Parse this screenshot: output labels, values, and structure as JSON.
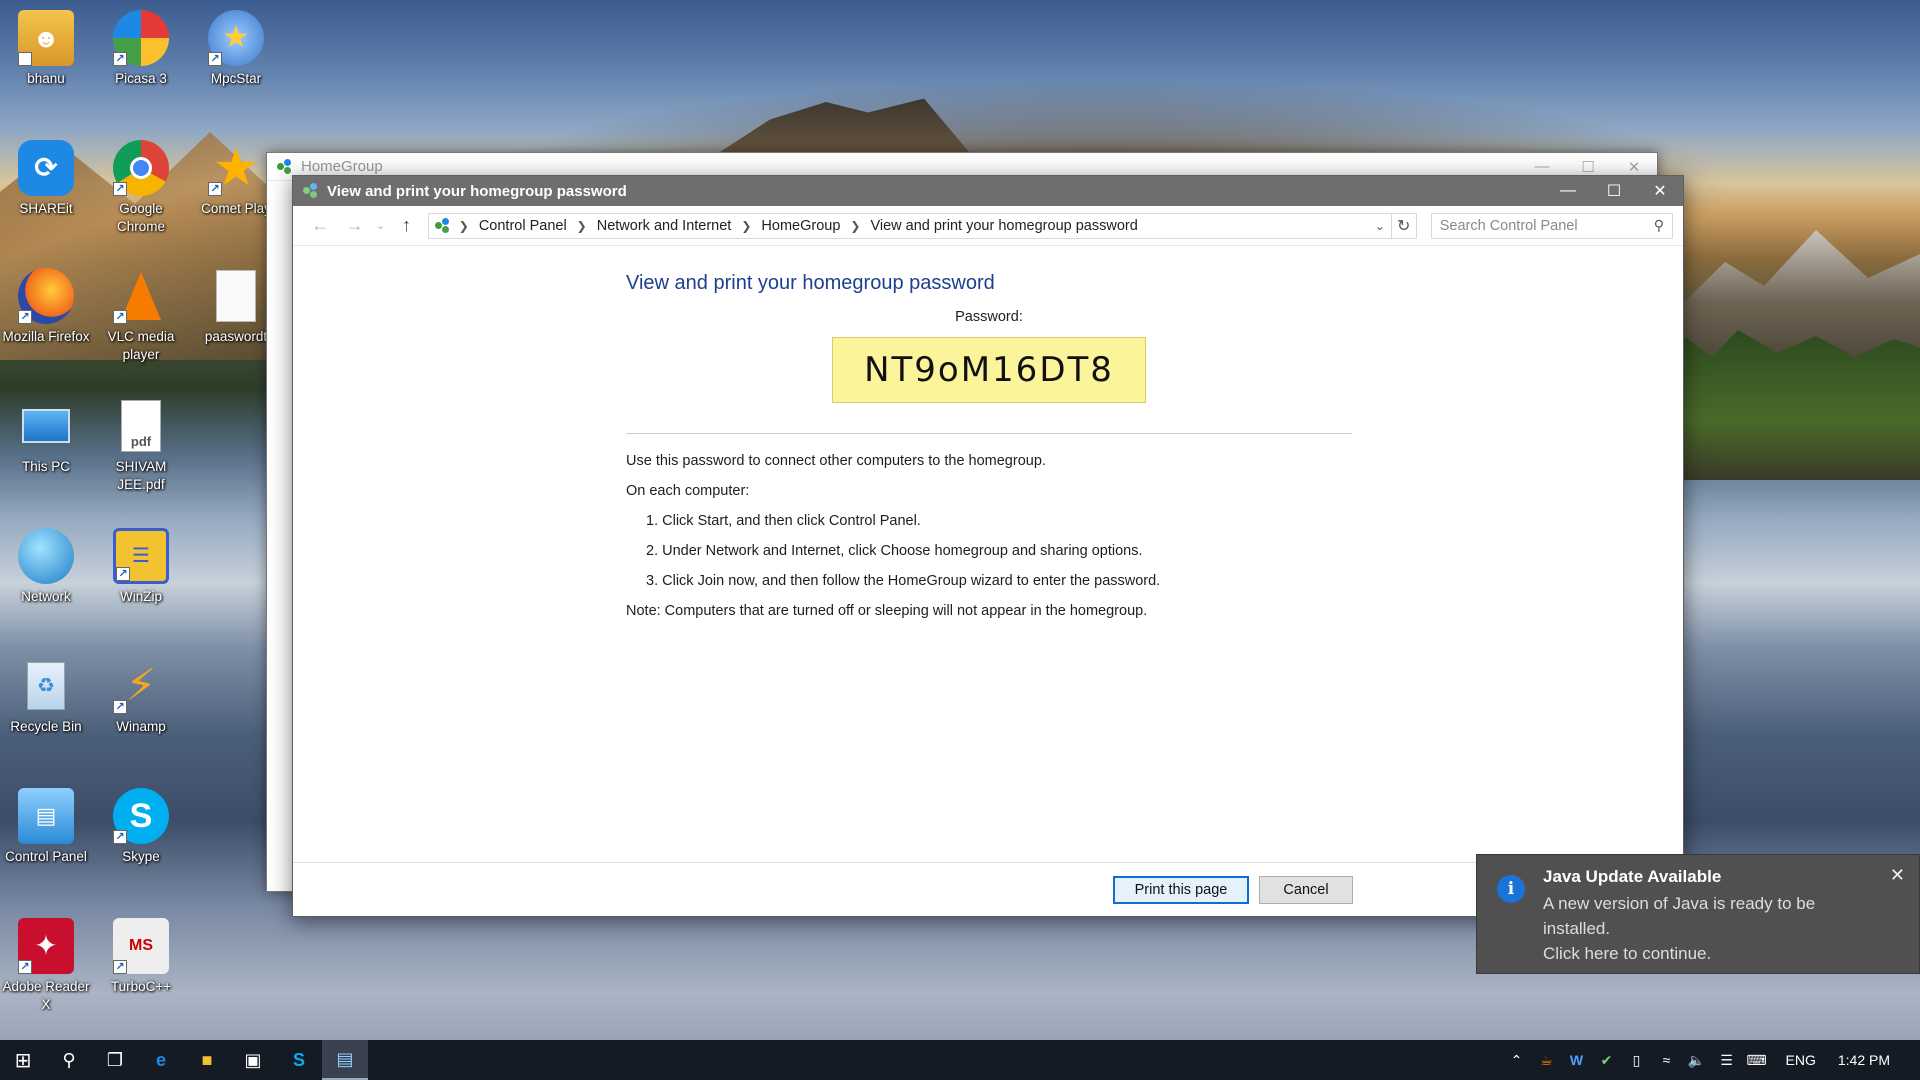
{
  "desktop": {
    "icons": [
      {
        "label": "bhanu"
      },
      {
        "label": "Picasa 3"
      },
      {
        "label": "MpcStar"
      },
      {
        "label": "SHAREit"
      },
      {
        "label": "Google Chrome"
      },
      {
        "label": "Comet Play"
      },
      {
        "label": "Mozilla Firefox"
      },
      {
        "label": "VLC media player"
      },
      {
        "label": "paaswordt"
      },
      {
        "label": "This PC"
      },
      {
        "label": "SHIVAM JEE.pdf"
      },
      {
        "label": "Network"
      },
      {
        "label": "WinZip"
      },
      {
        "label": "Recycle Bin"
      },
      {
        "label": "Winamp"
      },
      {
        "label": "Control Panel"
      },
      {
        "label": "Skype"
      },
      {
        "label": "Adobe Reader X"
      },
      {
        "label": "TurboC++"
      }
    ]
  },
  "back_window": {
    "title": "HomeGroup"
  },
  "front_window": {
    "title": "View and print your homegroup password",
    "breadcrumbs": [
      "Control Panel",
      "Network and Internet",
      "HomeGroup",
      "View and print your homegroup password"
    ],
    "search_placeholder": "Search Control Panel",
    "heading": "View and print your homegroup password",
    "password_label": "Password:",
    "password": "NT9oM16DT8",
    "intro": "Use this password to connect other computers to the homegroup.",
    "on_each": "On each computer:",
    "steps": [
      "1. Click Start, and then click Control Panel.",
      "2. Under Network and Internet, click Choose homegroup and sharing options.",
      "3. Click Join now, and then follow the HomeGroup wizard to enter the password."
    ],
    "note": "Note: Computers that are turned off or sleeping will not appear in the homegroup.",
    "print_button": "Print this page",
    "cancel_button": "Cancel"
  },
  "toast": {
    "title": "Java Update Available",
    "body_line1": "A new version of Java is ready to be installed.",
    "body_line2": "Click here to continue."
  },
  "taskbar": {
    "language": "ENG",
    "time": "1:42 PM"
  },
  "colors": {
    "titlebar": "#6e6e6e",
    "heading_blue": "#1e3f8e",
    "password_bg": "#fcf49a",
    "toast_bg": "#505050",
    "taskbar_bg": "#151b24",
    "primary_border": "#0f6dd2"
  }
}
